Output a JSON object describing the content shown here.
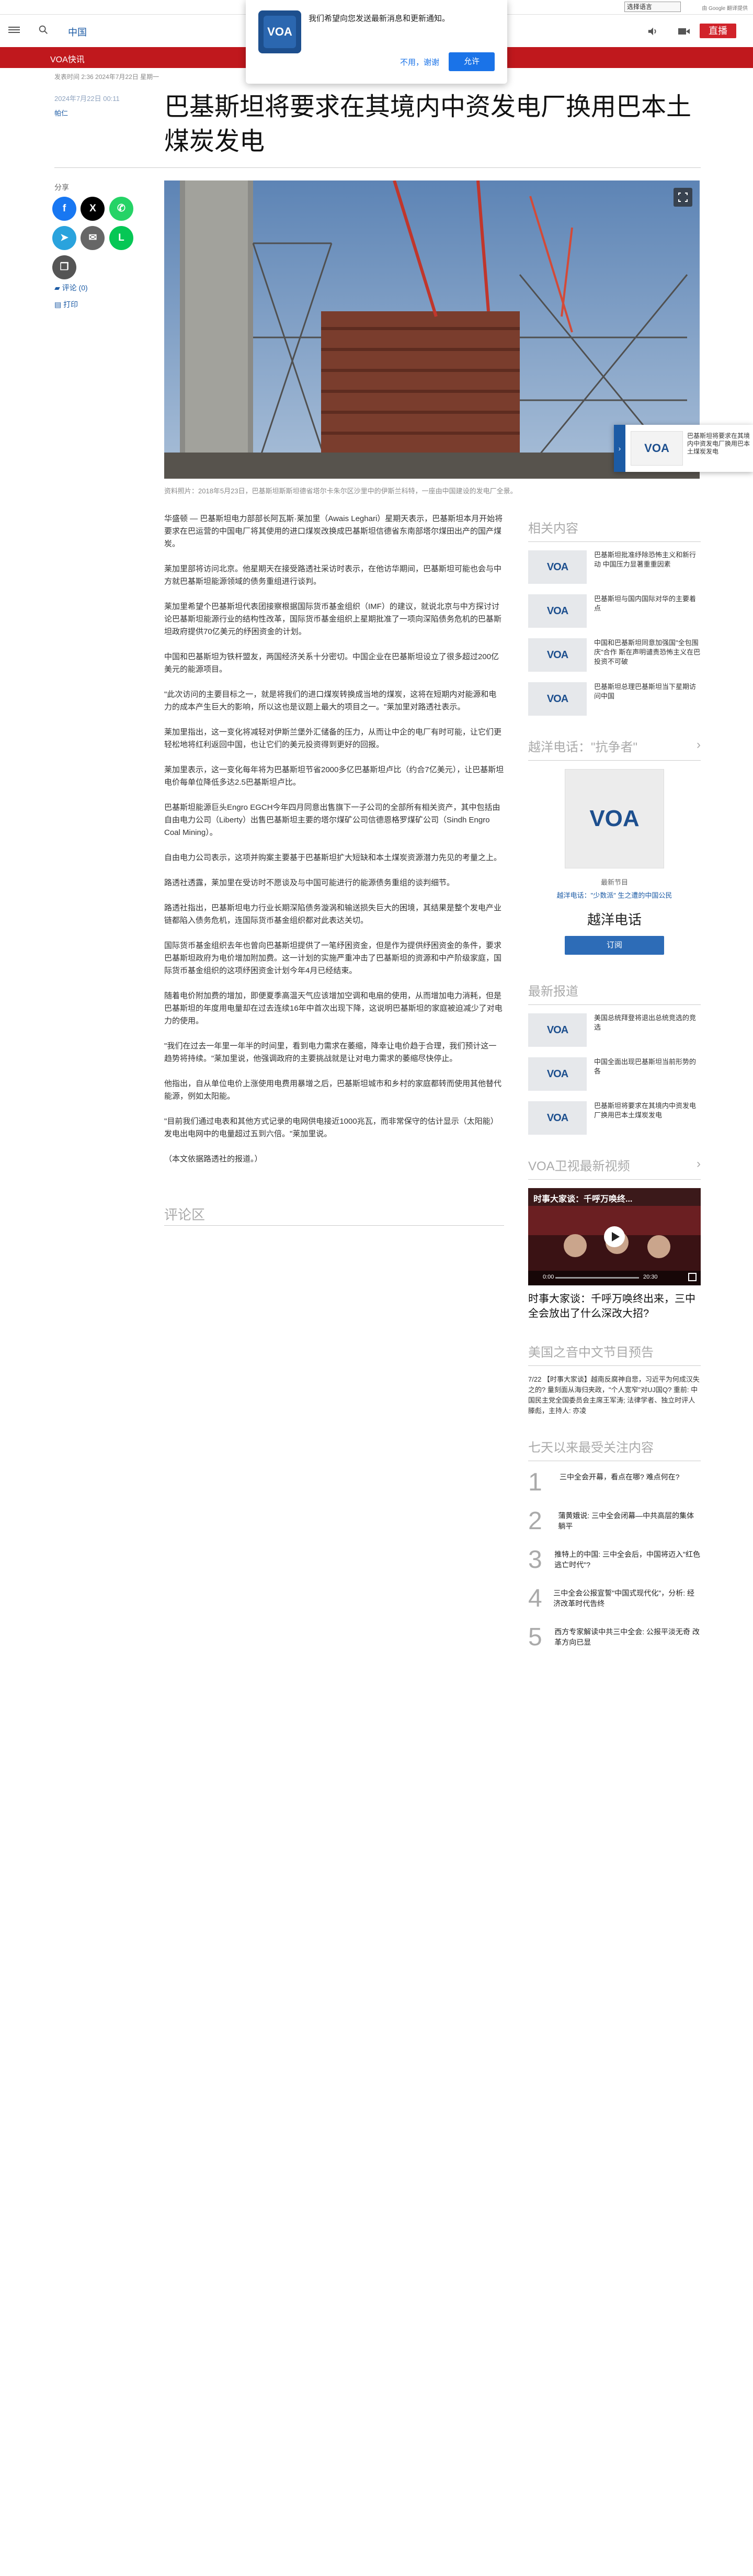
{
  "utility": {
    "language_select": "选择语言",
    "powered_by": "由 Google 翻译提供"
  },
  "header": {
    "region": "中国",
    "live_label": "直播"
  },
  "notification": {
    "message": "我们希望向您发送最新消息和更新通知。",
    "decline": "不用，谢谢",
    "allow": "允许"
  },
  "banner": {
    "label": "VOA快讯"
  },
  "article": {
    "meta_top": "发表时间 2:36 2024年7月22日 星期一",
    "published": "2024年7月22日 00:11",
    "author": "帕仁",
    "title": "巴基斯坦将要求在其境内中资发电厂换用巴本土煤炭发电",
    "image_caption": "资料照片：2018年5月23日，巴基斯坦斯斯坦德省塔尔卡朱尔区沙里中的伊斯兰科特，一座由中国建设的发电厂全景。",
    "paragraphs": [
      "华盛顿 — 巴基斯坦电力部部长阿瓦斯·莱加里（Awais Leghari）星期天表示，巴基斯坦本月开始将要求在巴运营的中国电厂将其使用的进口煤炭改换成巴基斯坦信德省东南部塔尔煤田出产的国产煤炭。",
      "莱加里部将访问北京。他星期天在接受路透社采访时表示，在他访华期间，巴基斯坦可能也会与中方就巴基斯坦能源领域的债务重组进行谈判。",
      "莱加里希望个巴基斯坦代表团接察根据国际货币基金组织（IMF）的建议，就说北京与中方探讨讨论巴基斯坦能源行业的结构性改革，国际货币基金组织上星期批准了一项向深陷债务危机的巴基斯坦政府提供70亿美元的纾困资金的计划。",
      "中国和巴基斯坦为铁杆盟友，两国经济关系十分密切。中国企业在巴基斯坦设立了很多超过200亿美元的能源项目。",
      "\"此次访问的主要目标之一，就是将我们的进口煤炭转换成当地的煤炭，这将在短期内对能源和电力的成本产生巨大的影响，所以这也是议题上最大的项目之一。\"莱加里对路透社表示。",
      "莱加里指出，这一变化将减轻对伊斯兰堡外汇储备的压力，从而让中企的电厂有时可能，让它们更轻松地将红利返回中国，也让它们的美元投资得到更好的回报。",
      "莱加里表示，这一变化每年将为巴基斯坦节省2000多亿巴基斯坦卢比（约合7亿美元），让巴基斯坦电价每单位降低多达2.5巴基斯坦卢比。",
      "巴基斯坦能源巨头Engro EGCH今年四月同意出售旗下一子公司的全部所有相关资产，其中包括由自由电力公司（Liberty）出售巴基斯坦主要的塔尔煤矿公司信德恩格罗煤矿公司（Sindh Engro Coal Mining）。",
      "自由电力公司表示，这项并购案主要基于巴基斯坦扩大短缺和本土煤炭资源潜力先见的考量之上。",
      "路透社透露，莱加里在受访时不愿谈及与中国可能进行的能源债务重组的谈判细节。",
      "路透社指出，巴基斯坦电力行业长期深陷债务漩涡和输送损失巨大的困境，其结果是整个发电产业链都陷入债务危机，连国际货币基金组织都对此表达关切。",
      "国际货币基金组织去年也曾向巴基斯坦提供了一笔纾困资金，但是作为提供纾困资金的条件，要求巴基斯坦政府为电价增加附加费。这一计划的实施严重冲击了巴基斯坦的资源和中产阶级家庭，国际货币基金组织的这项纾困资金计划今年4月已经结束。",
      "随着电价附加费的增加，即便夏季高温天气应该增加空调和电扇的使用，从而增加电力消耗，但是巴基斯坦的年度用电量却在过去连续16年中首次出现下降，这说明巴基斯坦的家庭被迫减少了对电力的使用。",
      "\"我们在过去一年里一年半的时间里，看到电力需求在萎缩，降幸让电价趋于合理，我们预计这一趋势将持续。\"莱加里说，他强调政府的主要挑战就是让对电力需求的萎缩尽快停止。",
      "他指出，自从单位电价上涨使用电费用暴增之后，巴基斯坦城市和乡村的家庭都转而使用其他替代能源，例如太阳能。",
      "\"目前我们通过电表和其他方式记录的电网供电接近1000兆瓦，而非常保守的估计显示（太阳能）发电出电网中的电量超过五到六倍。\"莱加里说。",
      "（本文依据路透社的报道。）"
    ],
    "comments_heading": "评论区"
  },
  "share": {
    "label": "分享",
    "comments_link": "评论 (0)",
    "print_link": "打印"
  },
  "mini_player": {
    "title": "巴基斯坦将要求在其境内中资发电厂换用巴本土煤炭发电"
  },
  "sidebar": {
    "related": {
      "title": "相关内容",
      "items": [
        "巴基斯坦批准纾除恐怖主义和新行动 中国压力显著重重因素",
        "巴基斯坦与国内国际对华的主要着点",
        "中国和巴基斯坦同意加强国\"全包围庆\"合作 斯在声明谴责恐怖主义在巴投资不可破",
        "巴基斯坦总理巴基斯坦当下星期访问中国"
      ]
    },
    "blog": {
      "title": "越洋电话：\"抗争者\"",
      "kicker": "最新节目",
      "subtitle": "越洋电话：\"少数派\" 生之遭的中国公民",
      "name": "越洋电话",
      "subscribe": "订阅"
    },
    "latest": {
      "title": "最新报道",
      "items": [
        "美国总统拜登将退出总统竞选的竞选",
        "中国全面出现巴基斯坦当前形势的各",
        "巴基斯坦将要求在其境内中资发电厂换用巴本土煤炭发电"
      ]
    },
    "video": {
      "title": "VOA卫视最新视频",
      "headline": "时事大家谈：千呼万唤终出来，三中全会放出了什么深改大招?",
      "overlay_title": "时事大家谈：千呼万唤终...",
      "time": "0:00",
      "duration": "20:30"
    },
    "program": {
      "title": "美国之音中文节目预告",
      "text": "7/22 【时事大家谈】越南反腐神自悲，习近平为何成汉失之的? 量刻面从海归夹政，\"个人宽窄\"对UJ国Q? 重前: 中国民主党全国委员会主席王军涛; 法律学者、独立时评人滕彪，主持人: 亦凌"
    },
    "top_stories": {
      "title": "七天以来最受关注内容",
      "items": [
        {
          "num": "1",
          "text": "三中全会开幕，看点在哪? 难点何在?"
        },
        {
          "num": "2",
          "text": "蒲黄娥说: 三中全会闭幕—中共高层的集体躺平"
        },
        {
          "num": "3",
          "text": "推特上的中国: 三中全会后，中国将迈入\"红色逃亡时代\"?"
        },
        {
          "num": "4",
          "text": "三中全会公报宣誓\"中国式现代化\"，分析: 经济改革时代告终"
        },
        {
          "num": "5",
          "text": "西方专家解读中共三中全会: 公报平淡无奇 改革方向已显"
        }
      ]
    }
  },
  "colors": {
    "brand_blue": "#1c5ba5",
    "live_red": "#d1232a",
    "banner_red": "#c0181d"
  }
}
